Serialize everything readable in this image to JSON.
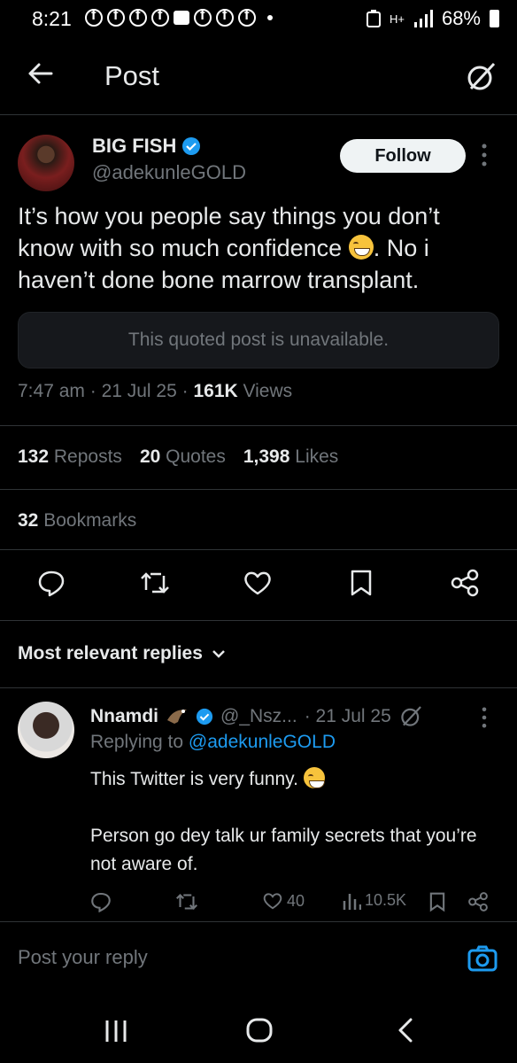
{
  "status_bar": {
    "time": "8:21",
    "network": "H+",
    "battery": "68%"
  },
  "header": {
    "title": "Post"
  },
  "post": {
    "author_name": "BIG FISH",
    "author_handle": "@adekunleGOLD",
    "follow_label": "Follow",
    "text_line1": "It’s how you people say things you don’t",
    "text_line2_a": "know with so much confidence",
    "text_line2_b": ". No i",
    "text_line3": "haven’t done bone marrow transplant.",
    "quoted_unavailable": "This quoted post is unavailable.",
    "time": "7:47 am",
    "date": "21 Jul 25",
    "views_count": "161K",
    "views_label": "Views",
    "reposts_count": "132",
    "reposts_label": "Reposts",
    "quotes_count": "20",
    "quotes_label": "Quotes",
    "likes_count": "1,398",
    "likes_label": "Likes",
    "bookmarks_count": "32",
    "bookmarks_label": "Bookmarks"
  },
  "replies": {
    "sort_label": "Most relevant replies",
    "items": [
      {
        "name": "Nnamdi",
        "handle": "@_Nsz...",
        "date": "· 21 Jul 25",
        "replying_prefix": "Replying to",
        "replying_handle": "@adekunleGOLD",
        "text_p1": "This Twitter  is very funny.",
        "text_p2": "Person go dey talk ur family secrets that you’re not aware of.",
        "likes": "40",
        "views": "10.5K"
      }
    ]
  },
  "composer": {
    "placeholder": "Post your reply"
  },
  "colors": {
    "background": "#000000",
    "accent": "#1d9bf0",
    "muted": "#71767b",
    "text": "#e7e9ea"
  }
}
